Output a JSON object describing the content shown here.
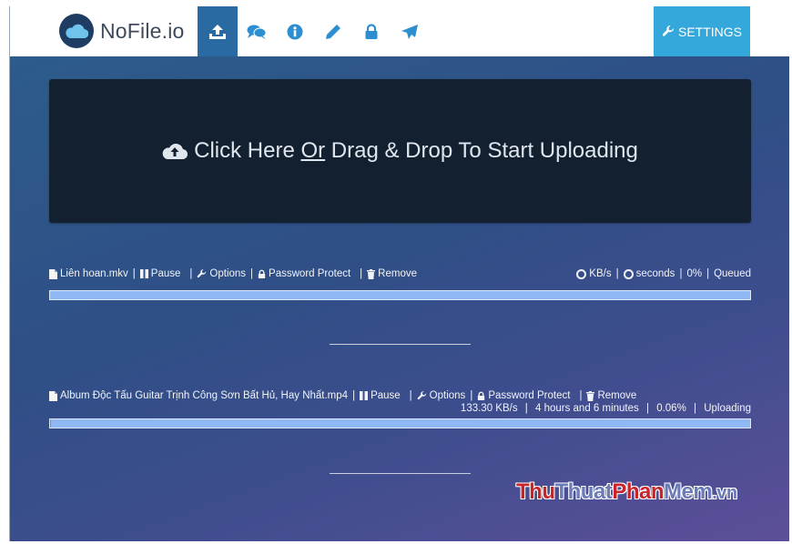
{
  "app": {
    "logo_text": "NoFile.io",
    "settings_label": "SETTINGS",
    "nav_icons": [
      "upload-icon",
      "comments-icon",
      "info-icon",
      "pencil-icon",
      "lock-icon",
      "send-icon"
    ]
  },
  "colors": {
    "accent": "#35a8db",
    "nav_active": "#2a6aa3",
    "dropzone_bg": "#13202f",
    "progress_bar": "#90b8f5"
  },
  "dropzone": {
    "text_before": "Click Here ",
    "text_or": "Or",
    "text_after": " Drag & Drop To Start Uploading"
  },
  "files": [
    {
      "name": "Liên hoan.mkv",
      "pause_label": "Pause",
      "options_label": "Options",
      "password_label": "Password Protect",
      "remove_label": "Remove",
      "speed": "KB/s",
      "time": "seconds",
      "percent": "0%",
      "state": "Queued",
      "progress": 0
    },
    {
      "name": "Album Độc Tấu Guitar Trịnh Công Sơn Bất Hủ, Hay Nhất.mp4",
      "pause_label": "Pause",
      "options_label": "Options",
      "password_label": "Password Protect",
      "remove_label": "Remove",
      "speed": "133.30 KB/s",
      "time": "4 hours and 6 minutes",
      "percent": "0.06%",
      "state": "Uploading",
      "progress": 0.0006
    }
  ],
  "watermark": {
    "part1": "Thu",
    "part2": "Thuat",
    "part3": "Phan",
    "part4": "Mem",
    "part5": ".vn"
  }
}
